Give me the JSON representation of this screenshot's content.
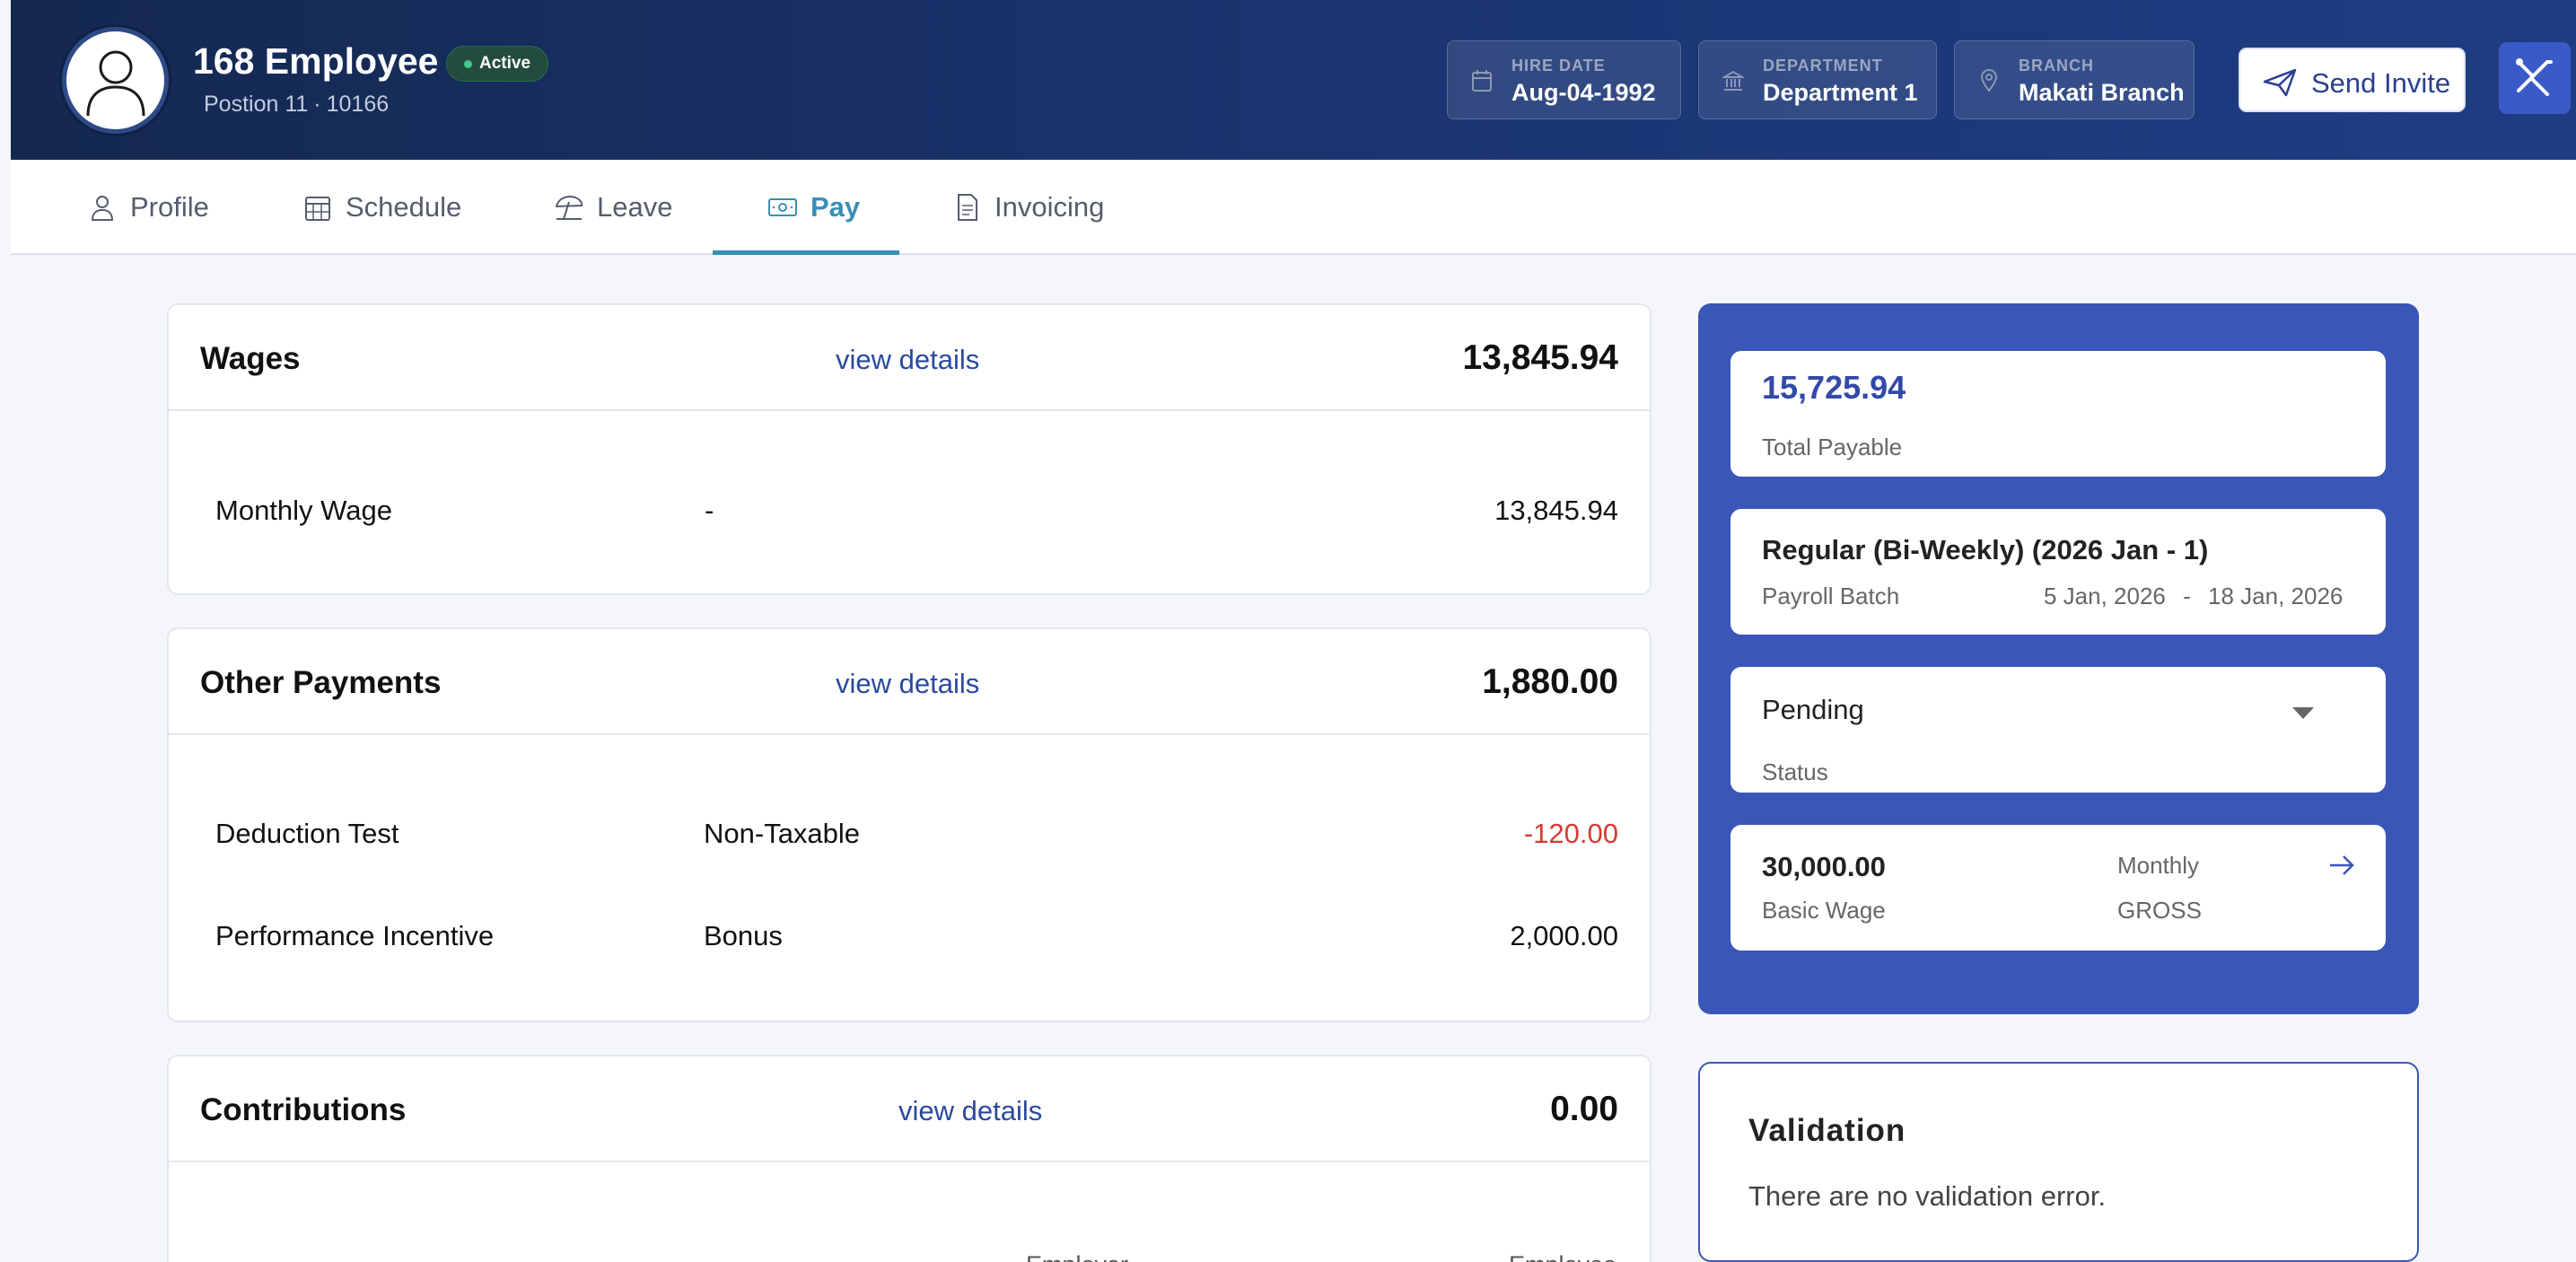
{
  "header": {
    "employee_name": "168 Employee",
    "status": "Active",
    "position": "Postion 11",
    "employee_id": "10166",
    "info": [
      {
        "label": "HIRE DATE",
        "value": "Aug-04-1992",
        "icon": "calendar-icon"
      },
      {
        "label": "DEPARTMENT",
        "value": "Department 1",
        "icon": "bank-icon"
      },
      {
        "label": "BRANCH",
        "value": "Makati Branch",
        "icon": "location-pin-icon"
      }
    ],
    "send_invite_label": "Send Invite"
  },
  "tabs": [
    {
      "label": "Profile",
      "icon": "person-icon"
    },
    {
      "label": "Schedule",
      "icon": "calendar-grid-icon"
    },
    {
      "label": "Leave",
      "icon": "beach-umbrella-icon"
    },
    {
      "label": "Pay",
      "icon": "cash-icon",
      "active": true
    },
    {
      "label": "Invoicing",
      "icon": "document-icon"
    }
  ],
  "wages": {
    "title": "Wages",
    "view_details": "view details",
    "total": "13,845.94",
    "rows": [
      {
        "label": "Monthly Wage",
        "type": "-",
        "amount": "13,845.94"
      }
    ]
  },
  "other_payments": {
    "title": "Other Payments",
    "view_details": "view details",
    "total": "1,880.00",
    "rows": [
      {
        "label": "Deduction Test",
        "type": "Non-Taxable",
        "amount": "-120.00"
      },
      {
        "label": "Performance Incentive",
        "type": "Bonus",
        "amount": "2,000.00"
      }
    ]
  },
  "contributions": {
    "title": "Contributions",
    "view_details": "view details",
    "total": "0.00",
    "col_employer": "Employer",
    "col_employee": "Employee"
  },
  "summary": {
    "total_payable_value": "15,725.94",
    "total_payable_label": "Total Payable",
    "batch_name": "Regular (Bi-Weekly) (2026 Jan - 1)",
    "batch_label": "Payroll Batch",
    "batch_start": "5 Jan, 2026",
    "batch_sep": "-",
    "batch_end": "18 Jan, 2026",
    "status_value": "Pending",
    "status_label": "Status",
    "basic_wage_value": "30,000.00",
    "basic_wage_label": "Basic Wage",
    "frequency": "Monthly",
    "wage_type": "GROSS"
  },
  "validation": {
    "title": "Validation",
    "message": "There are no validation error."
  },
  "colors": {
    "header_bg": "#1a3470",
    "accent": "#3a57b8",
    "tab_active": "#3a8fb5",
    "negative": "#d53b34",
    "status_dot": "#3cc98a"
  }
}
